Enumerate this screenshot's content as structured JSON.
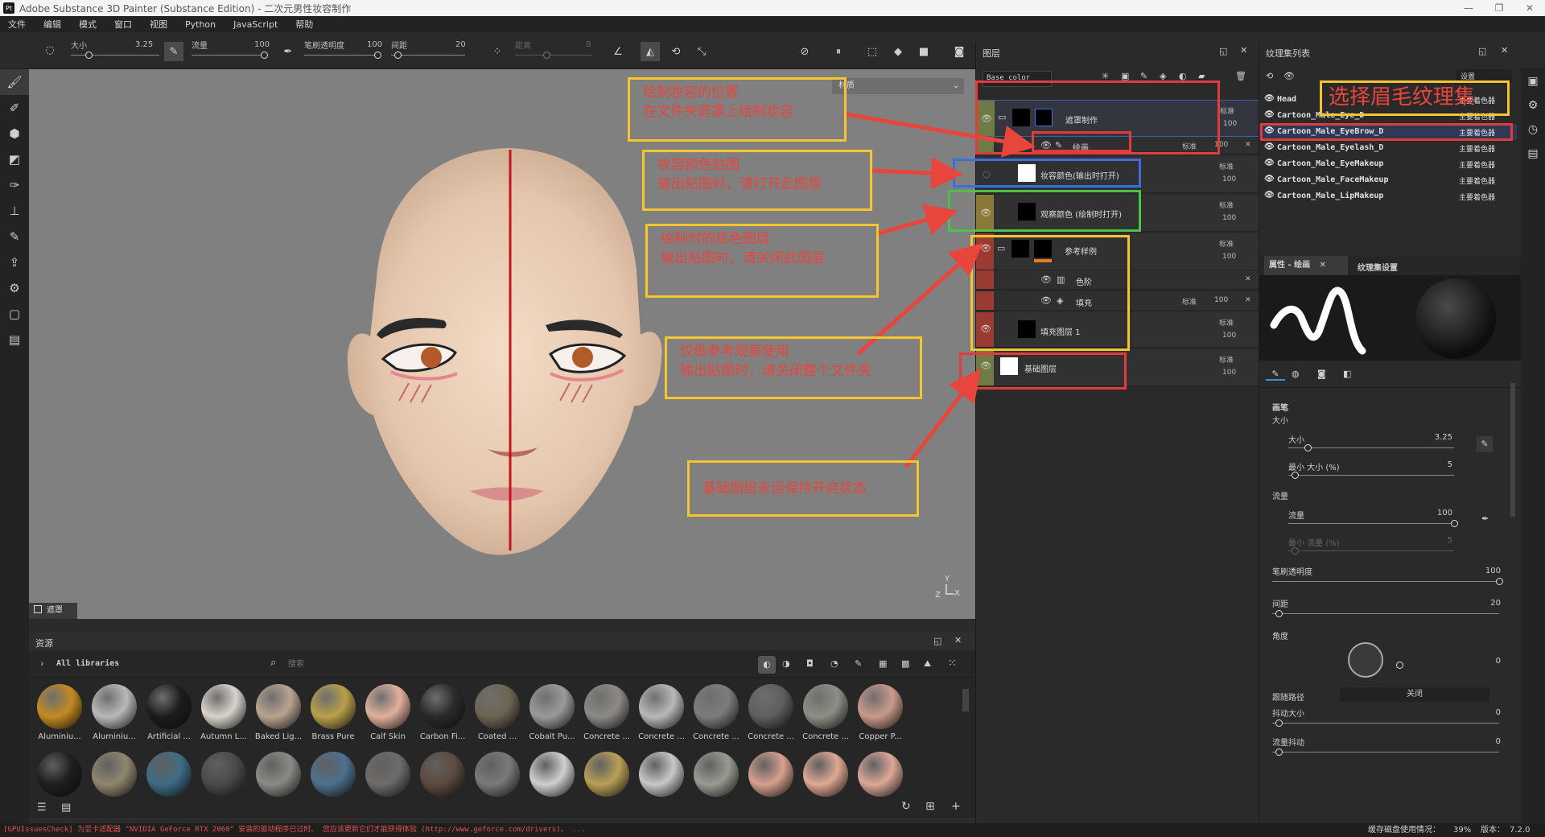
{
  "window": {
    "app_icon": "Pt",
    "title": "Adobe Substance 3D Painter (Substance Edition) - 二次元男性妆容制作",
    "controls": [
      "—",
      "❐",
      "✕"
    ]
  },
  "menu": [
    "文件",
    "编辑",
    "模式",
    "窗口",
    "视图",
    "Python",
    "JavaScript",
    "帮助"
  ],
  "toolbar": {
    "size_label": "大小",
    "size_value": "3.25",
    "flow_label": "流量",
    "flow_value": "100",
    "opacity_label": "笔刷透明度",
    "opacity_value": "100",
    "spacing_label": "间距",
    "spacing_value": "20",
    "jitter_label": "距离",
    "jitter_value": "8"
  },
  "viewport": {
    "channel_select": "材质",
    "mask_label": "遮罩",
    "axis_y": "Y",
    "axis_z": "Z",
    "axis_x": "X"
  },
  "assets": {
    "title": "资源",
    "libraries": "All libraries",
    "search_placeholder": "搜索",
    "row1": [
      {
        "label": "Aluminiu...",
        "color": "#c48a22"
      },
      {
        "label": "Aluminiu...",
        "color": "#b9b9b9"
      },
      {
        "label": "Artificial ...",
        "color": "#1c1c1c"
      },
      {
        "label": "Autumn L...",
        "color": "#d8d3cc"
      },
      {
        "label": "Baked Lig...",
        "color": "#b8a48e"
      },
      {
        "label": "Brass Pure",
        "color": "#b8a04a"
      },
      {
        "label": "Calf Skin",
        "color": "#e2b09c"
      },
      {
        "label": "Carbon Fi...",
        "color": "#2a2a2a"
      },
      {
        "label": "Coated ...",
        "color": "#6c6552"
      },
      {
        "label": "Cobalt Pu...",
        "color": "#9a9a9a"
      },
      {
        "label": "Concrete ...",
        "color": "#8c8a86"
      },
      {
        "label": "Concrete ...",
        "color": "#b8b8b8"
      },
      {
        "label": "Concrete ...",
        "color": "#7c7c7a"
      },
      {
        "label": "Concrete ...",
        "color": "#5e5e5e"
      },
      {
        "label": "Concrete ...",
        "color": "#8e8e86"
      },
      {
        "label": "Copper P...",
        "color": "#c99a8a"
      }
    ],
    "row2": [
      "#1e1e1e",
      "#8f866c",
      "#3e6c84",
      "#4a4a4a",
      "#8a8a86",
      "#4d708e",
      "#6e6c6a",
      "#5c4a40",
      "#7a7a7a",
      "#cfcfcf",
      "#b8a056",
      "#c8c8c8",
      "#9a9a92",
      "#d6a08e",
      "#e0a892",
      "#dca898"
    ]
  },
  "layers": {
    "title": "图层",
    "channel": "Base color",
    "items": [
      {
        "name": "遮罩制作",
        "blend": "标准",
        "opacity": "100"
      },
      {
        "name": "绘画",
        "blend": "标准",
        "opacity": "100"
      },
      {
        "name": "妆容颜色(输出时打开)",
        "blend": "标准",
        "opacity": "100"
      },
      {
        "name": "观察颜色 (绘制时打开)",
        "blend": "标准",
        "opacity": "100"
      },
      {
        "name": "参考样例",
        "blend": "标准",
        "opacity": "100"
      },
      {
        "name": "色阶"
      },
      {
        "name": "填充",
        "blend": "标准",
        "opacity": "100"
      },
      {
        "name": "填充图层 1",
        "blend": "标准",
        "opacity": "100"
      },
      {
        "name": "基础图层",
        "blend": "标准",
        "opacity": "100"
      }
    ]
  },
  "texture_sets": {
    "title": "纹理集列表",
    "sort_label": "设置",
    "items": [
      {
        "name": "Head",
        "shader": "主要着色器"
      },
      {
        "name": "Cartoon_Male_Eye_D",
        "shader": "主要着色器"
      },
      {
        "name": "Cartoon_Male_EyeBrow_D",
        "shader": "主要着色器"
      },
      {
        "name": "Cartoon_Male_Eyelash_D",
        "shader": "主要着色器"
      },
      {
        "name": "Cartoon_Male_EyeMakeup",
        "shader": "主要着色器"
      },
      {
        "name": "Cartoon_Male_FaceMakeup",
        "shader": "主要着色器"
      },
      {
        "name": "Cartoon_Male_LipMakeup",
        "shader": "主要着色器"
      }
    ]
  },
  "properties": {
    "tab_props": "属性 - 绘画",
    "tab_texset": "纹理集设置",
    "brush_section": "画笔",
    "size_group": "大小",
    "size_label": "大小",
    "size_value": "3.25",
    "min_size_label": "最小 大小 (%)",
    "min_size_value": "5",
    "flow_group": "流量",
    "flow_label": "流量",
    "flow_value": "100",
    "min_flow_label": "最小 流量 (%)",
    "min_flow_value": "5",
    "opacity_label": "笔刷透明度",
    "opacity_value": "100",
    "spacing_label": "间距",
    "spacing_value": "20",
    "angle_label": "角度",
    "angle_value": "0",
    "follow_path_label": "跟随路径",
    "follow_path_value": "关闭",
    "jitter_size_label": "抖动大小",
    "jitter_size_value": "0",
    "flow_jitter_label": "流量抖动",
    "flow_jitter_value": "0"
  },
  "annotations": {
    "a1_line1": "绘制妆容的位置",
    "a1_line2": "在文件夹遮罩上绘制妆容",
    "a2_line1": "妆容颜色贴图",
    "a2_line2": "输出贴图时，请打开此图层",
    "a3_line1": "绘制时的底色图层",
    "a3_line2": "输出贴图时，请关闭此图层",
    "a4_line1": "仅做参考观察使用",
    "a4_line2": "输出贴图时，请关闭整个文件夹",
    "a5_line1": "基础图层永远保持开启状态",
    "a6": "选择眉毛纹理集"
  },
  "status": {
    "warning": "[GPUIssuesCheck] 为显卡适配器 \"NVIDIA GeForce RTX 2060\" 安装的驱动程序已过时。 您应该更新它们才能获得体验 (http://www.geforce.com/drivers)。 ...",
    "cache_label": "缓存磁盘使用情况：",
    "cache_value": "39%",
    "version_label": "版本：",
    "version_value": "7.2.0"
  },
  "colors": {
    "accent_red": "#e8453c",
    "anno_yellow": "#f5c531",
    "box_blue": "#3b6fe0",
    "box_green": "#4cc24c",
    "box_red": "#e33b3b",
    "orange": "#e57a22"
  }
}
